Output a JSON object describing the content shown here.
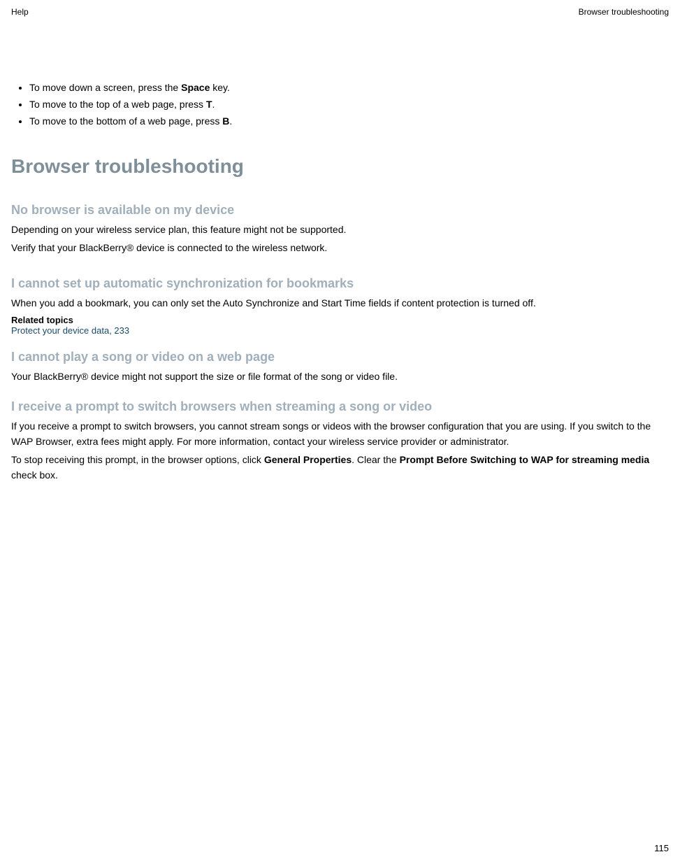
{
  "header": {
    "left": "Help",
    "right": "Browser troubleshooting"
  },
  "tips": {
    "item1_prefix": "To move down a screen, press the ",
    "item1_key": "Space",
    "item1_suffix": " key.",
    "item2_prefix": "To move to the top of a web page, press ",
    "item2_key": "T",
    "item2_suffix": ".",
    "item3_prefix": "To move to the bottom of a web page, press ",
    "item3_key": "B",
    "item3_suffix": "."
  },
  "headings": {
    "h1": "Browser troubleshooting",
    "no_browser": "No browser is available on my device",
    "cannot_sync": "I cannot set up automatic synchronization for bookmarks",
    "cannot_play": "I cannot play a song or video on a web page",
    "switch_prompt": "I receive a prompt to switch browsers when streaming a song or video"
  },
  "paras": {
    "no_browser_p1": "Depending on your wireless service plan, this feature might not be supported.",
    "no_browser_p2": "Verify that your BlackBerry® device is connected to the wireless network.",
    "cannot_sync_p1": "When you add a bookmark, you can only set the Auto Synchronize and Start Time fields if content protection is turned off.",
    "cannot_play_p1": "Your BlackBerry® device might not support the size or file format of the song or video file.",
    "switch_p1": "If you receive a prompt to switch browsers, you cannot stream songs or videos with the browser configuration that you are using. If you switch to the WAP Browser, extra fees might apply. For more information, contact your wireless service provider or administrator.",
    "switch_p2_a": "To stop receiving this prompt, in the browser options, click ",
    "switch_p2_gp": "General Properties",
    "switch_p2_b": ". Clear the ",
    "switch_p2_prompt": "Prompt Before Switching to WAP for streaming media",
    "switch_p2_c": " check box."
  },
  "related": {
    "heading": "Related topics",
    "link": "Protect your device data, 233"
  },
  "page_number": "115"
}
